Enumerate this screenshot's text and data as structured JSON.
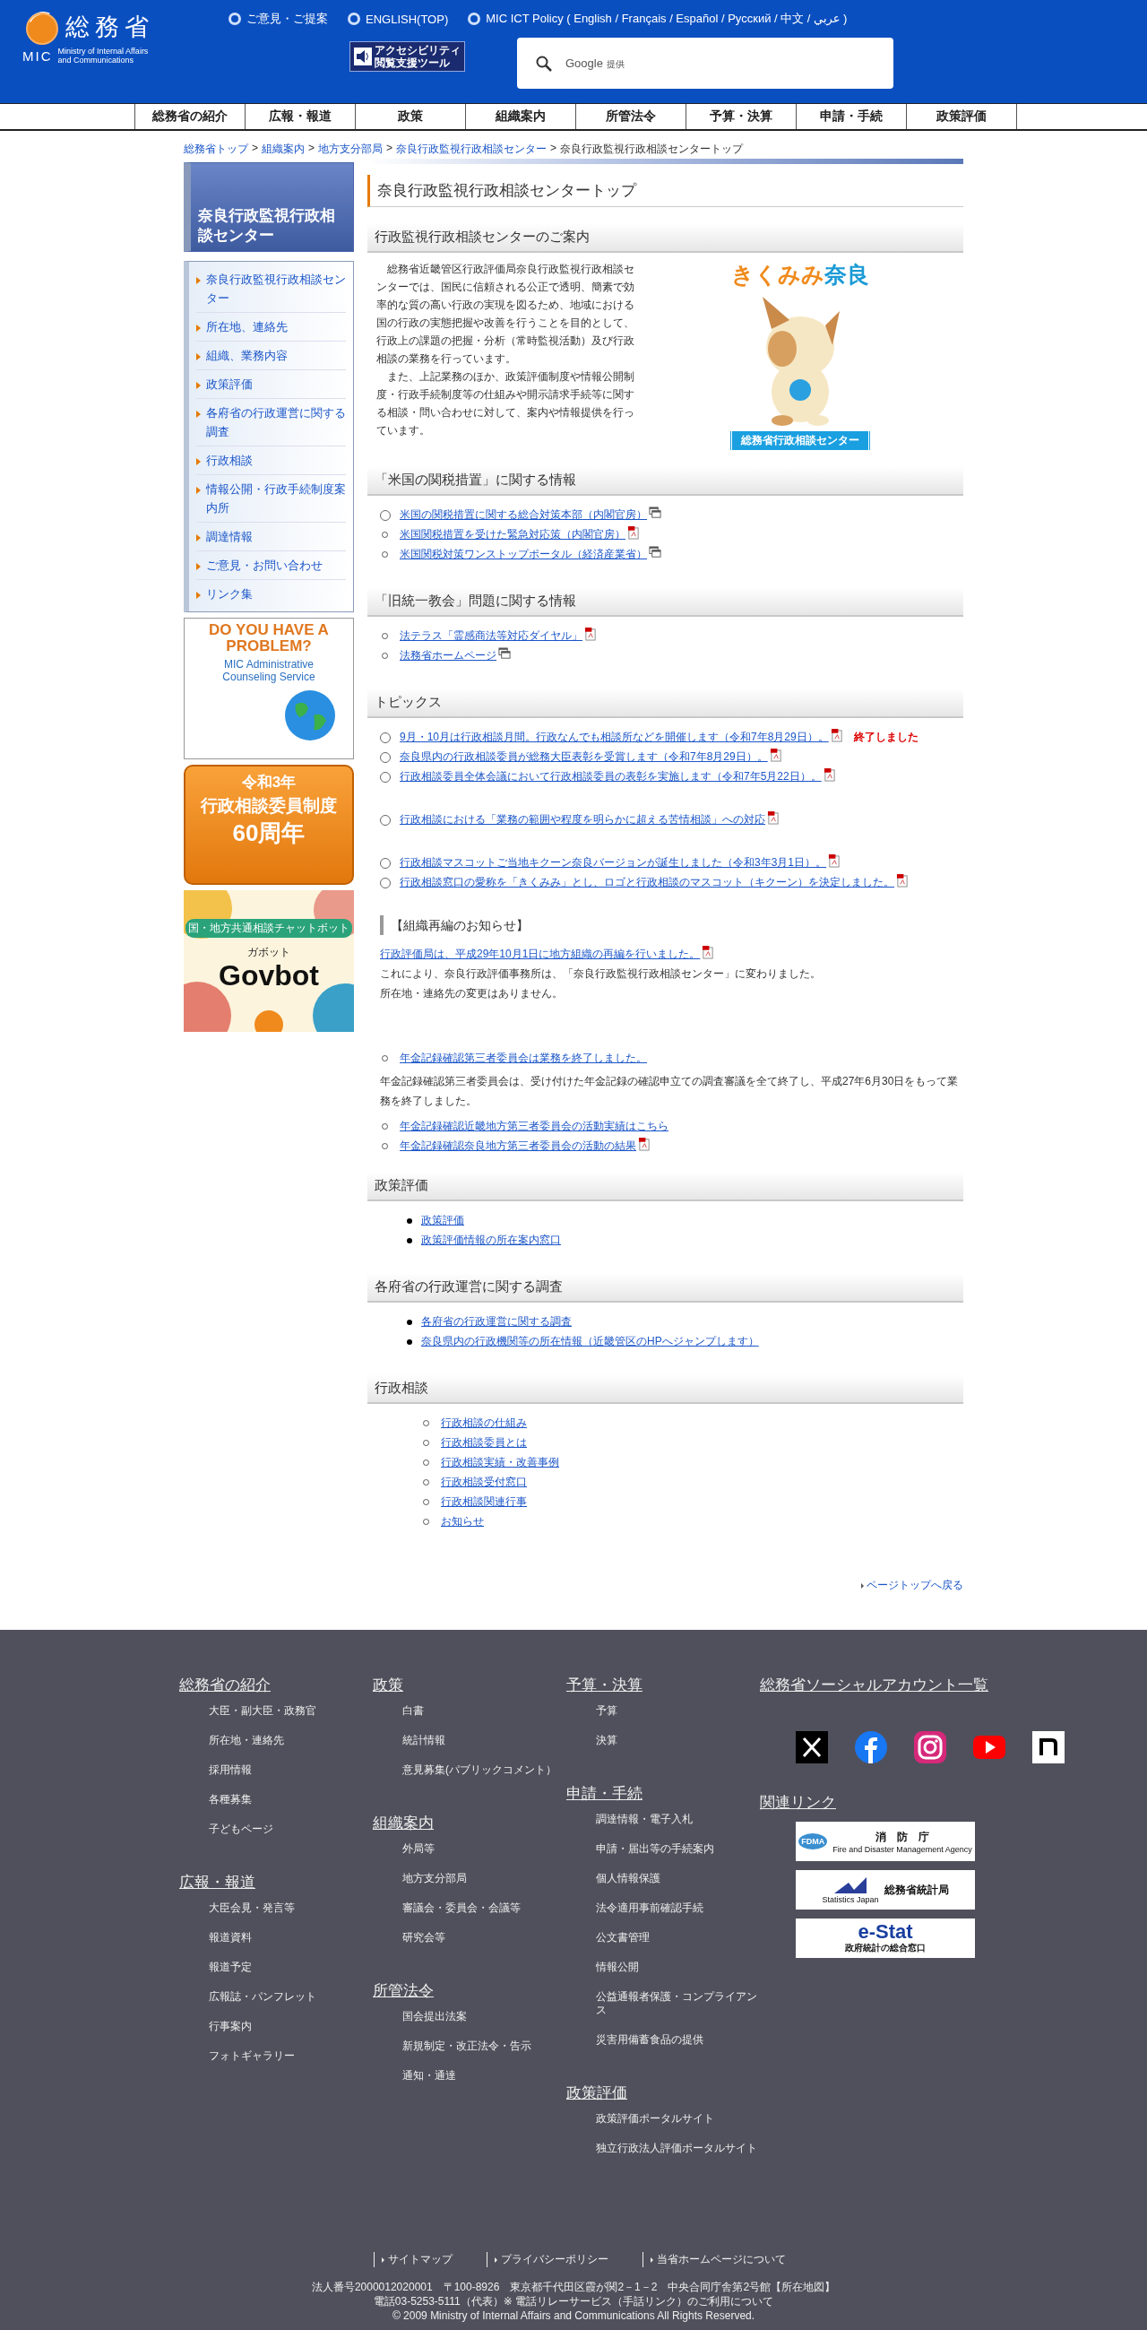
{
  "header": {
    "logo": {
      "name": "総務省",
      "abbr": "MIC",
      "english": "Ministry of Internal Affairs and Communications"
    },
    "top_links": [
      "ご意見・ご提案",
      "ENGLISH(TOP)",
      "MIC ICT Policy ( English / Français / Español / Русский / 中文 / عربي )"
    ],
    "accessibility_tool": {
      "line_1": "アクセシビリティ",
      "line_2": "閲覧支援ツール"
    },
    "search": {
      "brand": "Google",
      "note": "提供"
    }
  },
  "nav": [
    "総務省の紹介",
    "広報・報道",
    "政策",
    "組織案内",
    "所管法令",
    "予算・決算",
    "申請・手続",
    "政策評価"
  ],
  "breadcrumb": {
    "links": [
      {
        "text": "総務省トップ",
        "separator": ">"
      },
      {
        "text": "組織案内",
        "separator": ">"
      },
      {
        "text": "地方支分部局",
        "separator": ">"
      },
      {
        "text": "奈良行政監視行政相談センター",
        "separator": ">"
      }
    ],
    "current": "奈良行政監視行政相談センタートップ"
  },
  "sidebar": {
    "title": "奈良行政監視行政相談センター",
    "items": [
      "奈良行政監視行政相談センター",
      "所在地、連絡先",
      "組織、業務内容",
      "政策評価",
      "各府省の行政運営に関する調査",
      "行政相談",
      "情報公開・行政手続制度案内所",
      "調達情報",
      "ご意見・お問い合わせ",
      "リンク集"
    ],
    "banners": [
      {
        "kind": "problem",
        "headline": "DO YOU HAVE A PROBLEM?",
        "subline": "MIC Administrative Counseling Service"
      },
      {
        "kind": "anniversary",
        "line_1": "令和3年",
        "line_2": "行政相談委員制度",
        "line_3": "60周年"
      },
      {
        "kind": "chatbot",
        "tag": "国・地方共通相談チャットボット",
        "reading": "ガボット",
        "name": "Govbot"
      }
    ]
  },
  "main": {
    "title": "奈良行政監視行政相談センタートップ",
    "intro": {
      "heading": "行政監視行政相談センターのご案内",
      "paragraphs": [
        "総務省近畿管区行政評価局奈良行政監視行政相談センターでは、国民に信頼される公正で透明、簡素で効率的な質の高い行政の実現を図るため、地域における国の行政の実態把握や改善を行うことを目的として、行政上の課題の把握・分析（常時監視活動）及び行政相談の業務を行っています。",
        "また、上記業務のほか、政策評価制度や情報公開制度・行政手続制度等の仕組みや開示請求手続等に関する相談・問い合わせに対して、案内や情報提供を行っています。"
      ],
      "logo_word": "きくみみ",
      "logo_place": "奈良",
      "badge": "総務省行政相談センター"
    },
    "sections": [
      {
        "heading": "「米国の関税措置」に関する情報",
        "groups": [
          [
            {
              "text": "米国の関税措置に関する総合対策本部（内閣官房）",
              "bullet": {
                "kind": "radio"
              },
              "attachment": {
                "kind": "window"
              }
            },
            {
              "text": "米国関税措置を受けた緊急対応策（内閣官房）",
              "bullet": {
                "kind": "circle"
              },
              "attachment": {
                "kind": "pdf"
              }
            },
            {
              "text": "米国関税対策ワンストップポータル（経済産業省）",
              "bullet": {
                "kind": "circle"
              },
              "attachment": {
                "kind": "window"
              }
            }
          ]
        ]
      },
      {
        "heading": "「旧統一教会」問題に関する情報",
        "groups": [
          [
            {
              "text": "法テラス「霊感商法等対応ダイヤル」",
              "bullet": {
                "kind": "circle"
              },
              "attachment": {
                "kind": "pdf"
              }
            },
            {
              "text": "法務省ホームページ",
              "bullet": {
                "kind": "circle"
              },
              "attachment": {
                "kind": "window"
              }
            }
          ]
        ]
      },
      {
        "heading": "トピックス",
        "groups": [
          [
            {
              "text": "9月・10月は行政相談月間。行政なんでも相談所などを開催します（令和7年8月29日）。",
              "bullet": {
                "kind": "radio"
              },
              "attachment": {
                "kind": "pdf"
              },
              "note": "終了しました"
            },
            {
              "text": "奈良県内の行政相談委員が総務大臣表彰を受賞します（令和7年8月29日）。",
              "bullet": {
                "kind": "radio"
              },
              "attachment": {
                "kind": "pdf"
              }
            },
            {
              "text": "行政相談委員全体会議において行政相談委員の表彰を実施します（令和7年5月22日）。",
              "bullet": {
                "kind": "radio"
              },
              "attachment": {
                "kind": "pdf"
              }
            }
          ],
          [
            {
              "text": "行政相談における「業務の範囲や程度を明らかに超える苦情相談」への対応",
              "bullet": {
                "kind": "radio"
              },
              "attachment": {
                "kind": "pdf"
              }
            }
          ],
          [
            {
              "text": "行政相談マスコットご当地キクーン奈良バージョンが誕生しました（令和3年3月1日）。",
              "bullet": {
                "kind": "radio"
              },
              "attachment": {
                "kind": "pdf"
              }
            },
            {
              "text": "行政相談窓口の愛称を「きくみみ」とし、ロゴと行政相談のマスコット（キクーン）を決定しました。",
              "bullet": {
                "kind": "radio"
              },
              "attachment": {
                "kind": "pdf"
              }
            }
          ]
        ],
        "notice": {
          "heading": "【組織再編のお知らせ】",
          "link": {
            "text": "行政評価局は、平成29年10月1日に地方組織の再編を行いました。",
            "attachment": {
              "kind": "pdf"
            }
          },
          "paragraphs": [
            "これにより、奈良行政評価事務所は、「奈良行政監視行政相談センター」に変わりました。",
            "所在地・連絡先の変更はありません。"
          ]
        },
        "pension": {
          "link": {
            "text": "年金記録確認第三者委員会は業務を終了しました。",
            "bullet": {
              "kind": "circle"
            }
          },
          "paragraph": "年金記録確認第三者委員会は、受け付けた年金記録の確認申立ての調査審議を全て終了し、平成27年6月30日をもって業務を終了しました。",
          "links": [
            {
              "text": "年金記録確認近畿地方第三者委員会の活動実績はこちら",
              "bullet": {
                "kind": "circle"
              }
            },
            {
              "text": "年金記録確認奈良地方第三者委員会の活動の結果",
              "bullet": {
                "kind": "circle"
              },
              "attachment": {
                "kind": "pdf"
              }
            }
          ]
        }
      },
      {
        "heading": "政策評価",
        "groups": [
          [
            {
              "text": "政策評価",
              "bullet": {
                "kind": "disc"
              }
            },
            {
              "text": "政策評価情報の所在案内窓口",
              "bullet": {
                "kind": "disc"
              }
            }
          ]
        ]
      },
      {
        "heading": "各府省の行政運営に関する調査",
        "groups": [
          [
            {
              "text": "各府省の行政運営に関する調査",
              "bullet": {
                "kind": "disc"
              }
            },
            {
              "text": "奈良県内の行政機関等の所在情報（近畿管区のHPへジャンプします）",
              "bullet": {
                "kind": "disc"
              }
            }
          ]
        ]
      },
      {
        "heading": "行政相談",
        "groups": [
          [
            {
              "text": "行政相談の仕組み",
              "bullet": {
                "kind": "nested_circle"
              }
            },
            {
              "text": "行政相談委員とは",
              "bullet": {
                "kind": "nested_circle"
              }
            },
            {
              "text": "行政相談実績・改善事例",
              "bullet": {
                "kind": "nested_circle"
              }
            },
            {
              "text": "行政相談受付窓口",
              "bullet": {
                "kind": "nested_circle"
              }
            },
            {
              "text": "行政相談関連行事",
              "bullet": {
                "kind": "nested_circle"
              }
            },
            {
              "text": "お知らせ",
              "bullet": {
                "kind": "nested_circle"
              }
            }
          ]
        ]
      }
    ],
    "page_top": "ページトップへ戻る"
  },
  "footer": {
    "columns": [
      [
        {
          "heading": "総務省の紹介",
          "links": [
            "大臣・副大臣・政務官",
            "所在地・連絡先",
            "採用情報",
            "各種募集",
            "子どもページ"
          ]
        },
        {
          "heading": "広報・報道",
          "links": [
            "大臣会見・発言等",
            "報道資料",
            "報道予定",
            "広報誌・パンフレット",
            "行事案内",
            "フォトギャラリー"
          ]
        }
      ],
      [
        {
          "heading": "政策",
          "links": [
            "白書",
            "統計情報",
            "意見募集(パブリックコメント）"
          ]
        },
        {
          "heading": "組織案内",
          "links": [
            "外局等",
            "地方支分部局",
            "審議会・委員会・会議等",
            "研究会等"
          ]
        },
        {
          "heading": "所管法令",
          "links": [
            "国会提出法案",
            "新規制定・改正法令・告示",
            "通知・通達"
          ]
        }
      ],
      [
        {
          "heading": "予算・決算",
          "links": [
            "予算",
            "決算"
          ]
        },
        {
          "heading": "申請・手続",
          "links": [
            "調達情報・電子入札",
            "申請・届出等の手続案内",
            "個人情報保護",
            "法令適用事前確認手続",
            "公文書管理",
            "情報公開",
            "公益通報者保護・コンプライアンス",
            "災害用備蓄食品の提供"
          ]
        },
        {
          "heading": "政策評価",
          "links": [
            "政策評価ポータルサイト",
            "独立行政法人評価ポータルサイト"
          ]
        }
      ]
    ],
    "social": {
      "heading": "総務省ソーシャルアカウント一覧",
      "accounts": [
        {
          "kind": "x"
        },
        {
          "kind": "facebook"
        },
        {
          "kind": "instagram"
        },
        {
          "kind": "youtube"
        },
        {
          "kind": "note"
        }
      ]
    },
    "related": {
      "heading": "関連リンク",
      "banners": [
        {
          "kind": "fdma",
          "mark": "FDMA",
          "name": "消　防　庁",
          "english": "Fire and Disaster Management Agency"
        },
        {
          "kind": "stat",
          "name": "総務省統計局",
          "english": "Statistics Japan"
        },
        {
          "kind": "estat",
          "name": "e-Stat",
          "note": "政府統計の総合窓口"
        }
      ]
    },
    "bottom_links": [
      "サイトマップ",
      "プライバシーポリシー",
      "当省ホームページについて"
    ],
    "address": {
      "text": "法人番号2000012020001　〒100-8926　東京都千代田区霞が関2－1－2　中央合同庁舎第2号館【",
      "map_link": "所在地図",
      "map_link_close": "】",
      "phone": "電話03-5253-5111（代表）",
      "relay_link": "※ 電話リレーサービス（手話リンク）のご利用について"
    },
    "copyright": "© 2009 Ministry of Internal Affairs and Communications All Rights Reserved."
  }
}
